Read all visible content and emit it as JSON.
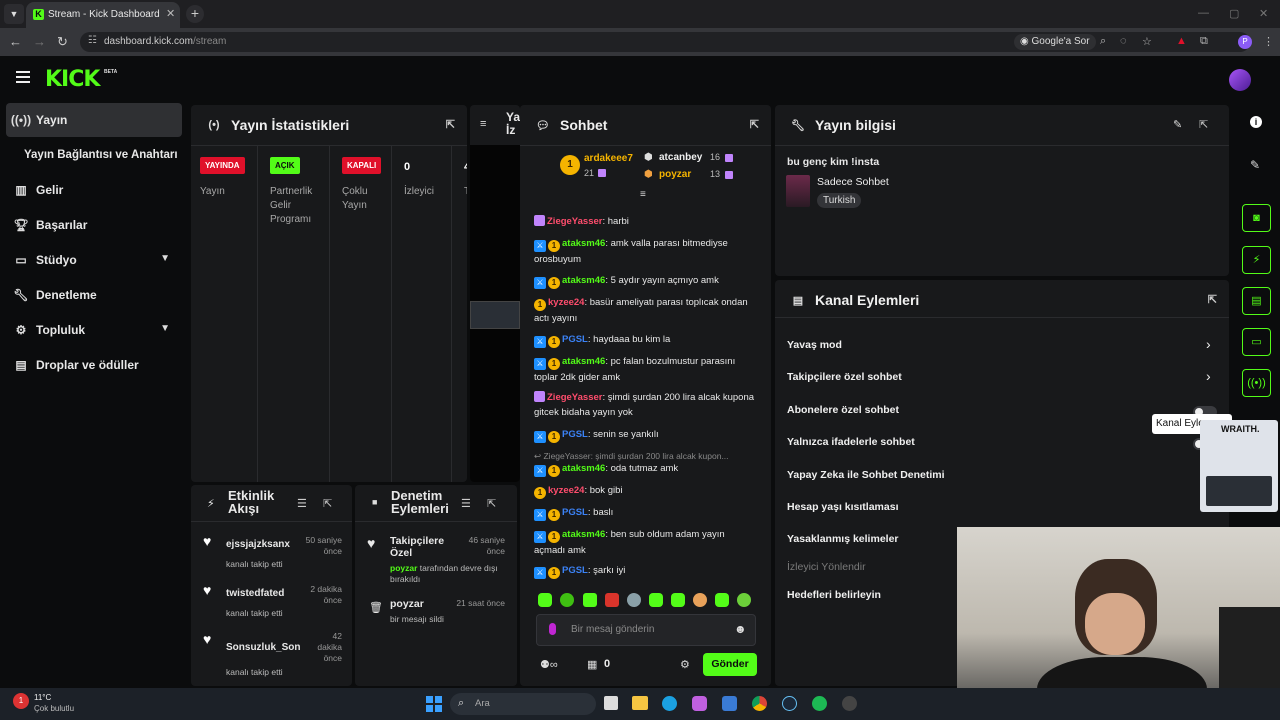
{
  "browser": {
    "tab_title": "Stream - Kick Dashboard",
    "url_host": "dashboard.kick.com",
    "url_path": "/stream",
    "google_lens_label": "Google'a Sor",
    "profile_initial": "P"
  },
  "header": {
    "logo": "KICK",
    "logo_badge": "BETA"
  },
  "sidebar": {
    "items": [
      {
        "label": "Yayın",
        "icon": "broadcast-icon"
      },
      {
        "label": "Yayın Bağlantısı ve Anahtarı"
      },
      {
        "label": "Gelir",
        "icon": "chart-icon"
      },
      {
        "label": "Başarılar",
        "icon": "trophy-icon"
      },
      {
        "label": "Stüdyo",
        "icon": "studio-icon"
      },
      {
        "label": "Denetleme",
        "icon": "wrench-icon"
      },
      {
        "label": "Topluluk",
        "icon": "community-icon"
      },
      {
        "label": "Droplar ve ödüller",
        "icon": "gift-icon"
      }
    ]
  },
  "stats": {
    "title": "Yayın İstatistikleri",
    "cols": [
      {
        "badge": "YAYINDA",
        "label": "Yayın",
        "color": "#e0102a"
      },
      {
        "badge": "AÇIK",
        "label": "Partnerlik Gelir Programı",
        "color": "#53fc18"
      },
      {
        "badge": "KAPALI",
        "label": "Çoklu Yayın",
        "color": "#e0102a"
      },
      {
        "badge": "0",
        "label": "İzleyici"
      },
      {
        "badge": "4",
        "label": "T"
      }
    ]
  },
  "preview": {
    "title_partial": "Ya İz"
  },
  "activity": {
    "title": "Etkinlik Akışı",
    "items": [
      {
        "user": "ejssjajzksanx",
        "action": "kanalı takip etti",
        "time": "50 saniye önce"
      },
      {
        "user": "twistedfated",
        "action": "kanalı takip etti",
        "time": "2 dakika önce"
      },
      {
        "user": "Sonsuzluk_Son",
        "action": "kanalı takip etti",
        "time": "42 dakika önce"
      }
    ]
  },
  "mod_actions": {
    "title": "Denetim Eylemleri",
    "items": [
      {
        "title": "Takipçilere Özel",
        "user": "poyzar",
        "desc": " tarafından devre dışı bırakıldı",
        "time": "46 saniye önce"
      },
      {
        "title": "poyzar",
        "desc": "bir mesajı sildi",
        "time": "21 saat önce"
      }
    ]
  },
  "chat": {
    "title": "Sohbet",
    "leaders": [
      {
        "rank": "1",
        "name": "ardakeee7",
        "count": "21"
      },
      {
        "name": "atcanbey",
        "count": "16"
      },
      {
        "name": "poyzar",
        "count": "13"
      }
    ],
    "messages": [
      {
        "user": "ZiegeYasser",
        "text": "harbi"
      },
      {
        "user": "ataksm46",
        "text": "amk valla parası bitmediyse orosbuyum"
      },
      {
        "user": "ataksm46",
        "text": "5 aydır yayın açmıyo amk"
      },
      {
        "user": "kyzee24",
        "text": "basür ameliyatı parası toplıcak ondan actı yayını"
      },
      {
        "user": "PGSL",
        "text": "haydaaa bu kim la"
      },
      {
        "user": "ataksm46",
        "text": "pc falan bozulmustur parasını toplar 2dk gider amk"
      },
      {
        "user": "ZiegeYasser",
        "text": "şimdi şurdan 200 lira alcak kupona gitcek bidaha yayın yok"
      },
      {
        "user": "PGSL",
        "text": "senin se yankılı"
      },
      {
        "reply": "ZiegeYasser: şimdi şurdan 200 lira alcak kupon..."
      },
      {
        "user": "ataksm46",
        "text": "oda tutmaz amk"
      },
      {
        "user": "kyzee24",
        "text": "bok gibi"
      },
      {
        "user": "PGSL",
        "text": "baslı"
      },
      {
        "user": "ataksm46",
        "text": "ben sub oldum adam yayın açmadı amk"
      },
      {
        "user": "PGSL",
        "text": "şarkı iyi"
      }
    ],
    "input_placeholder": "Bir mesaj gönderin",
    "points": "0",
    "send_label": "Gönder"
  },
  "stream_info": {
    "title": "Yayın bilgisi",
    "stream_title": "bu genç kim !insta",
    "category": "Sadece Sohbet",
    "language": "Turkish"
  },
  "channel_actions": {
    "title": "Kanal Eylemleri",
    "items": [
      {
        "label": "Yavaş mod"
      },
      {
        "label": "Takipçilere özel sohbet"
      },
      {
        "label": "Abonelere özel sohbet"
      },
      {
        "label": "Yalnızca ifadelerle sohbet"
      },
      {
        "label": "Yapay Zeka ile Sohbet Denetimi"
      },
      {
        "label": "Hesap yaşı kısıtlaması"
      },
      {
        "label": "Yasaklanmış kelimeler"
      },
      {
        "label": "İzleyici Yönlendir"
      },
      {
        "label": "Hedefleri belirleyin"
      }
    ],
    "tooltip": "Kanal Eyle"
  },
  "overlay": {
    "brand": "WRAITH."
  },
  "taskbar": {
    "temp": "11°C",
    "weather": "Çok bulutlu",
    "search_placeholder": "Ara"
  },
  "colors": {
    "accent": "#53fc18",
    "panel": "#18191b",
    "bg": "#0b0c0d"
  }
}
